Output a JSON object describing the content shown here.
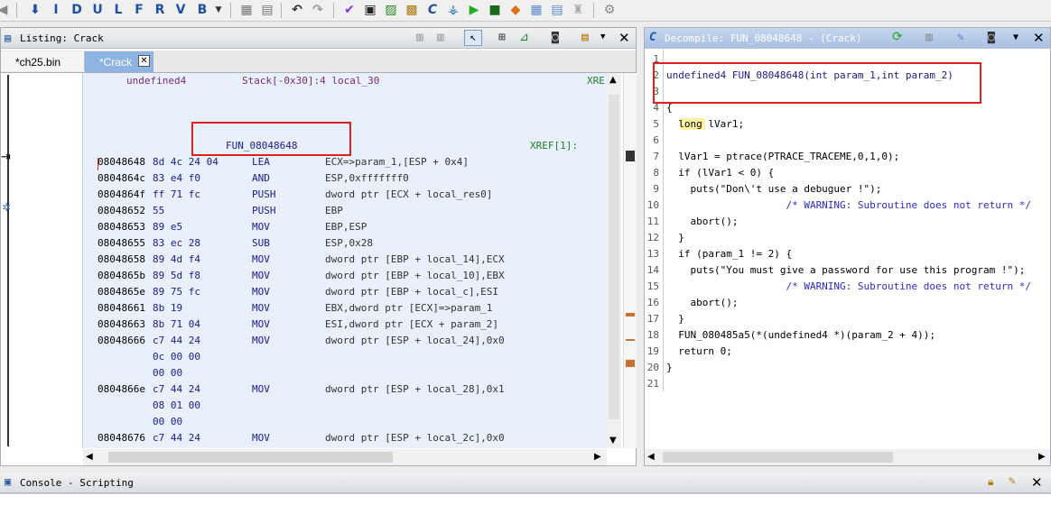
{
  "toolbar": {
    "letters": [
      "I",
      "D",
      "U",
      "L",
      "F",
      "R",
      "V",
      "B"
    ]
  },
  "listing": {
    "title": "Listing: Crack",
    "tabs": [
      {
        "label": "*ch25.bin"
      },
      {
        "label": "*Crack"
      }
    ],
    "header_line": {
      "type": "undefined4",
      "stack": "Stack[-0x30]:4 local_30",
      "xref": "XRE"
    },
    "func_label": "FUN_08048648",
    "xref1": "XREF[1]:",
    "rows": [
      {
        "addr": "08048648",
        "bytes": "8d 4c 24 04",
        "mnem": "LEA",
        "ops": "ECX=>param_1,[ESP + 0x4]"
      },
      {
        "addr": "0804864c",
        "bytes": "83 e4 f0",
        "mnem": "AND",
        "ops": "ESP,0xfffffff0"
      },
      {
        "addr": "0804864f",
        "bytes": "ff 71 fc",
        "mnem": "PUSH",
        "ops": "dword ptr [ECX + local_res0]"
      },
      {
        "addr": "08048652",
        "bytes": "55",
        "mnem": "PUSH",
        "ops": "EBP"
      },
      {
        "addr": "08048653",
        "bytes": "89 e5",
        "mnem": "MOV",
        "ops": "EBP,ESP"
      },
      {
        "addr": "08048655",
        "bytes": "83 ec 28",
        "mnem": "SUB",
        "ops": "ESP,0x28"
      },
      {
        "addr": "08048658",
        "bytes": "89 4d f4",
        "mnem": "MOV",
        "ops": "dword ptr [EBP + local_14],ECX"
      },
      {
        "addr": "0804865b",
        "bytes": "89 5d f8",
        "mnem": "MOV",
        "ops": "dword ptr [EBP + local_10],EBX"
      },
      {
        "addr": "0804865e",
        "bytes": "89 75 fc",
        "mnem": "MOV",
        "ops": "dword ptr [EBP + local_c],ESI"
      },
      {
        "addr": "08048661",
        "bytes": "8b 19",
        "mnem": "MOV",
        "ops": "EBX,dword ptr [ECX]=>param_1"
      },
      {
        "addr": "08048663",
        "bytes": "8b 71 04",
        "mnem": "MOV",
        "ops": "ESI,dword ptr [ECX + param_2]"
      },
      {
        "addr": "08048666",
        "bytes": "c7 44 24",
        "mnem": "MOV",
        "ops": "dword ptr [ESP + local_24],0x0"
      },
      {
        "addr": "",
        "bytes": "0c 00 00",
        "mnem": "",
        "ops": ""
      },
      {
        "addr": "",
        "bytes": "00 00",
        "mnem": "",
        "ops": ""
      },
      {
        "addr": "0804866e",
        "bytes": "c7 44 24",
        "mnem": "MOV",
        "ops": "dword ptr [ESP + local_28],0x1"
      },
      {
        "addr": "",
        "bytes": "08 01 00",
        "mnem": "",
        "ops": ""
      },
      {
        "addr": "",
        "bytes": "00 00",
        "mnem": "",
        "ops": ""
      },
      {
        "addr": "08048676",
        "bytes": "c7 44 24",
        "mnem": "MOV",
        "ops": "dword ptr [ESP + local_2c],0x0"
      }
    ]
  },
  "decompile": {
    "title": "Decompile: FUN_08048648 -  (Crack)",
    "lines": [
      {
        "n": "1",
        "text": ""
      },
      {
        "n": "2",
        "text": "undefined4 FUN_08048648(int param_1,int param_2)"
      },
      {
        "n": "3",
        "text": ""
      },
      {
        "n": "4",
        "text": "{"
      },
      {
        "n": "5",
        "text": "  long lVar1;"
      },
      {
        "n": "6",
        "text": ""
      },
      {
        "n": "7",
        "text": "  lVar1 = ptrace(PTRACE_TRACEME,0,1,0);"
      },
      {
        "n": "8",
        "text": "  if (lVar1 < 0) {"
      },
      {
        "n": "9",
        "text": "    puts(\"Don\\'t use a debuguer !\");"
      },
      {
        "n": "10",
        "text": "                    /* WARNING: Subroutine does not return */"
      },
      {
        "n": "11",
        "text": "    abort();"
      },
      {
        "n": "12",
        "text": "  }"
      },
      {
        "n": "13",
        "text": "  if (param_1 != 2) {"
      },
      {
        "n": "14",
        "text": "    puts(\"You must give a password for use this program !\");"
      },
      {
        "n": "15",
        "text": "                    /* WARNING: Subroutine does not return */"
      },
      {
        "n": "16",
        "text": "    abort();"
      },
      {
        "n": "17",
        "text": "  }"
      },
      {
        "n": "18",
        "text": "  FUN_080485a5(*(undefined4 *)(param_2 + 4));"
      },
      {
        "n": "19",
        "text": "  return 0;"
      },
      {
        "n": "20",
        "text": "}"
      },
      {
        "n": "21",
        "text": ""
      }
    ]
  },
  "console": {
    "title": "Console - Scripting"
  },
  "colors": {
    "accent_red": "#e02020",
    "listing_bg": "#e8f0fb",
    "highlight_yellow": "#fff3a0"
  }
}
